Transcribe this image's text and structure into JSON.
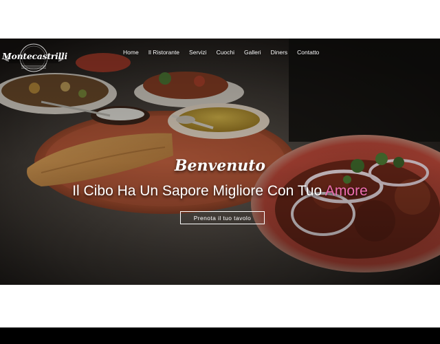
{
  "brand": {
    "name": "Montecastrilli",
    "logo_icon": "restaurant-emblem-icon"
  },
  "nav": {
    "items": [
      "Home",
      "Il Ristorante",
      "Servizi",
      "Cuochi",
      "Galleri",
      "Diners",
      "Contatto"
    ]
  },
  "hero": {
    "welcome": "Benvenuto",
    "tagline_main": "Il Cibo Ha Un Sapore Migliore Con Tuo ",
    "tagline_accent": "Amore",
    "cta_label": "Prenota il tuo tavolo"
  },
  "colors": {
    "accent": "#ee6fb2",
    "text": "#ffffff",
    "page_band": "#ffffff",
    "background": "#000000"
  }
}
